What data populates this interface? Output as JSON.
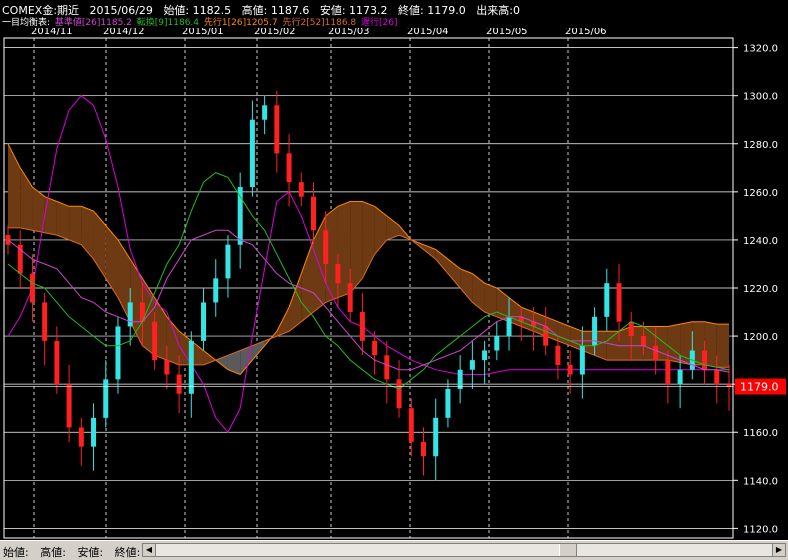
{
  "header": {
    "symbol": "COMEX金:期近",
    "date": "2015/06/29",
    "open": "始値: 1182.5",
    "high": "高値: 1187.6",
    "low": "安値: 1173.2",
    "close": "終値: 1179.0",
    "volume": "出来高:0"
  },
  "legend": {
    "prefix": "一目均衡表:",
    "kijun": "基準値[26]1185.2",
    "tenkan": "転換[9]1186.4",
    "span1": "先行1[26]1205.7",
    "span2": "先行2[52]1186.8",
    "chikou": "遅行[26]"
  },
  "colors": {
    "kijun": "#cc44cc",
    "tenkan": "#22bb22",
    "span1": "#ff8800",
    "span2": "#d86a28",
    "chikou": "#dd00dd",
    "up": "#33e6e6",
    "down": "#ff2020",
    "current_bg": "#ff0000"
  },
  "footer": {
    "open": "始値:",
    "high": "高値:",
    "low": "安値:",
    "close": "終値:"
  },
  "chart_data": {
    "type": "candlestick",
    "x_labels": [
      "2014/11",
      "2014/12",
      "2015/01",
      "2015/02",
      "2015/03",
      "2015/04",
      "2015/05",
      "2015/06"
    ],
    "y_ticks": [
      "1320.0",
      "1300.0",
      "1280.0",
      "1260.0",
      "1240.0",
      "1220.0",
      "1200.0",
      "1180.0",
      "1160.0",
      "1140.0",
      "1120.0"
    ],
    "ylim": [
      1116,
      1324
    ],
    "current_value": "1179.0",
    "grid": true,
    "series": [
      {
        "name": "基準値",
        "values": [
          1240,
          1236,
          1232,
          1230,
          1228,
          1222,
          1216,
          1214,
          1210,
          1208,
          1206,
          1206,
          1212,
          1224,
          1232,
          1240,
          1242,
          1244,
          1244,
          1240,
          1238,
          1232,
          1226,
          1222,
          1220,
          1218,
          1212,
          1206,
          1200,
          1194,
          1190,
          1188,
          1186,
          1186,
          1188,
          1190,
          1192,
          1194,
          1198,
          1202,
          1206,
          1208,
          1208,
          1206,
          1204,
          1200,
          1198,
          1198,
          1198,
          1197,
          1196,
          1196,
          1196,
          1194,
          1192,
          1190,
          1188,
          1186,
          1186,
          1185
        ]
      },
      {
        "name": "転換",
        "values": [
          1230,
          1226,
          1222,
          1220,
          1214,
          1208,
          1204,
          1200,
          1196,
          1196,
          1198,
          1206,
          1218,
          1230,
          1238,
          1252,
          1264,
          1268,
          1266,
          1258,
          1250,
          1244,
          1234,
          1224,
          1214,
          1208,
          1200,
          1196,
          1190,
          1186,
          1182,
          1180,
          1178,
          1182,
          1186,
          1192,
          1196,
          1200,
          1204,
          1208,
          1210,
          1208,
          1206,
          1204,
          1202,
          1200,
          1198,
          1196,
          1196,
          1198,
          1202,
          1206,
          1204,
          1200,
          1196,
          1192,
          1190,
          1188,
          1187,
          1186
        ]
      },
      {
        "name": "先行1",
        "values": [
          1280,
          1270,
          1262,
          1258,
          1256,
          1254,
          1254,
          1252,
          1246,
          1240,
          1232,
          1224,
          1216,
          1208,
          1202,
          1198,
          1194,
          1190,
          1186,
          1184,
          1190,
          1196,
          1202,
          1212,
          1226,
          1240,
          1250,
          1254,
          1256,
          1256,
          1254,
          1250,
          1246,
          1240,
          1238,
          1236,
          1232,
          1228,
          1226,
          1222,
          1220,
          1216,
          1212,
          1210,
          1208,
          1206,
          1204,
          1202,
          1202,
          1202,
          1202,
          1204,
          1204,
          1204,
          1204,
          1205,
          1206,
          1206,
          1205,
          1205
        ]
      },
      {
        "name": "先行2",
        "values": [
          1245,
          1245,
          1244,
          1243,
          1242,
          1240,
          1238,
          1232,
          1224,
          1216,
          1206,
          1196,
          1192,
          1190,
          1188,
          1188,
          1188,
          1190,
          1192,
          1194,
          1196,
          1198,
          1200,
          1202,
          1206,
          1210,
          1214,
          1216,
          1218,
          1224,
          1234,
          1240,
          1242,
          1240,
          1236,
          1232,
          1226,
          1220,
          1214,
          1210,
          1208,
          1206,
          1204,
          1202,
          1200,
          1198,
          1196,
          1194,
          1192,
          1190,
          1190,
          1190,
          1190,
          1190,
          1190,
          1189,
          1188,
          1188,
          1187,
          1187
        ]
      },
      {
        "name": "遅行",
        "values": [
          1200,
          1208,
          1220,
          1250,
          1278,
          1294,
          1300,
          1296,
          1282,
          1262,
          1236,
          1222,
          1214,
          1210,
          1196,
          1188,
          1180,
          1166,
          1160,
          1170,
          1200,
          1228,
          1256,
          1260,
          1250,
          1236,
          1222,
          1212,
          1206,
          1204,
          1200,
          1196,
          1193,
          1190,
          1188,
          1186,
          1185,
          1184,
          1184,
          1184,
          1185,
          1186,
          1186,
          1186,
          1186,
          1186,
          1186,
          1186,
          1186,
          1186,
          1186,
          1186,
          1186,
          1186,
          1186,
          1186,
          1186,
          1186,
          1186,
          1186
        ]
      },
      {
        "name": "close",
        "values": [
          1238,
          1226,
          1214,
          1198,
          1180,
          1162,
          1154,
          1166,
          1182,
          1204,
          1214,
          1206,
          1190,
          1184,
          1176,
          1198,
          1214,
          1224,
          1238,
          1262,
          1290,
          1296,
          1276,
          1264,
          1258,
          1244,
          1230,
          1222,
          1210,
          1198,
          1192,
          1182,
          1170,
          1156,
          1150,
          1166,
          1178,
          1186,
          1190,
          1194,
          1200,
          1208,
          1206,
          1204,
          1196,
          1188,
          1184,
          1196,
          1208,
          1222,
          1206,
          1200,
          1196,
          1190,
          1180,
          1186,
          1194,
          1186,
          1180,
          1179
        ]
      }
    ]
  }
}
